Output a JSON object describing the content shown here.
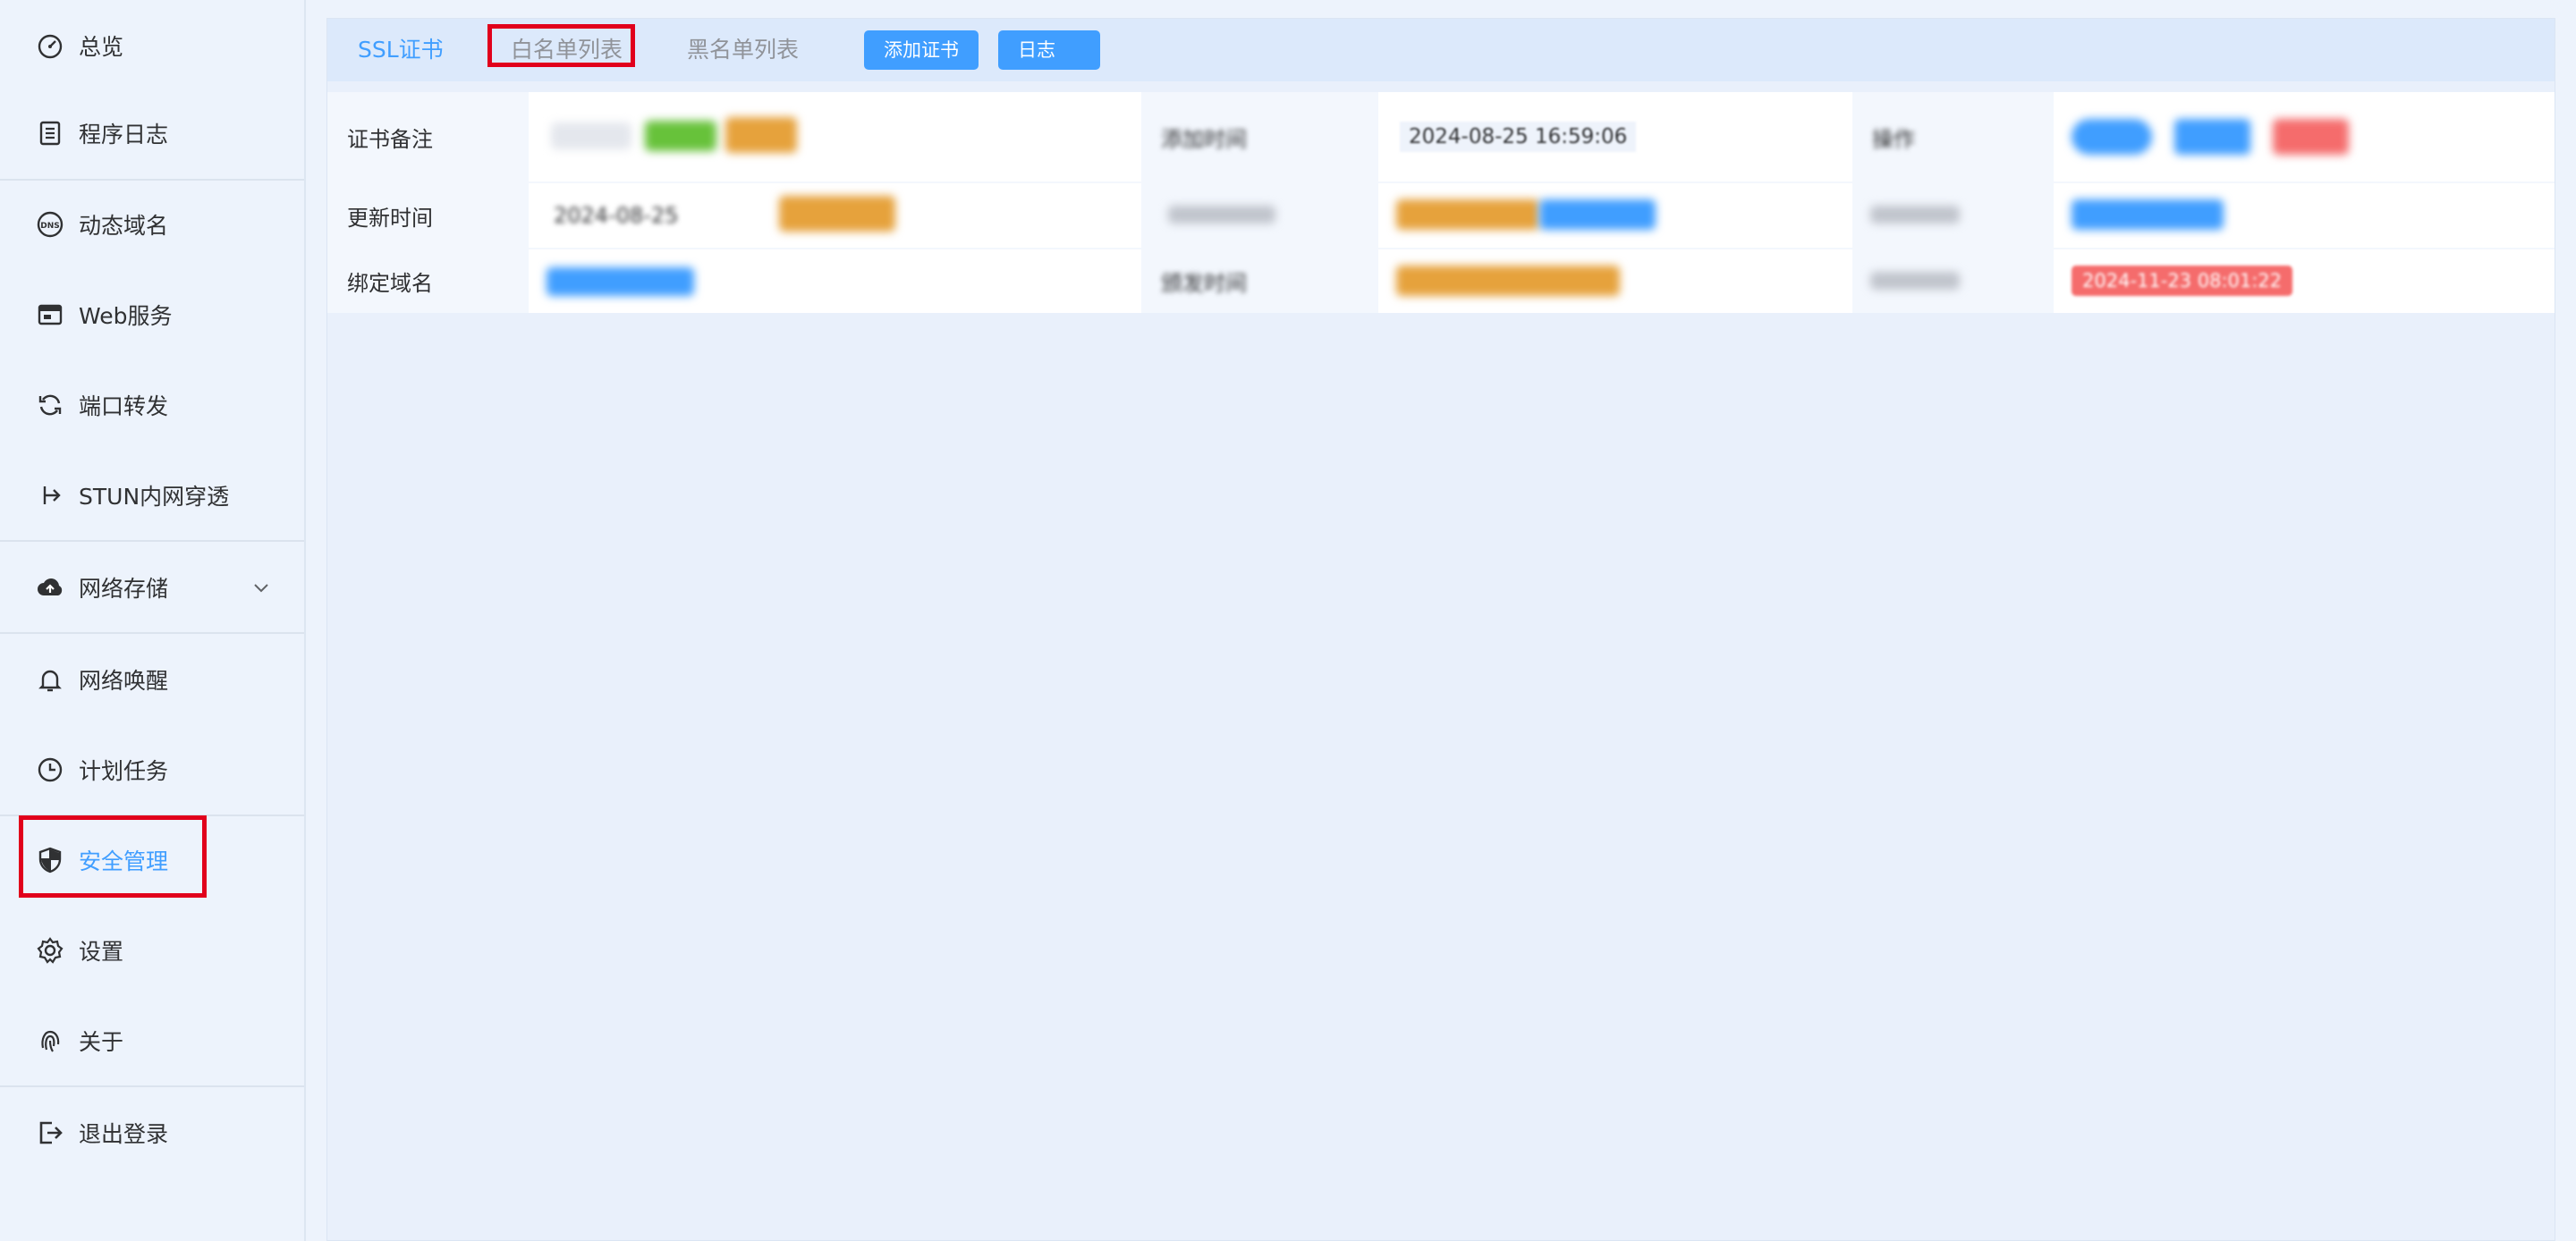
{
  "sidebar": {
    "items": [
      {
        "label": "总览",
        "icon": "dashboard-icon"
      },
      {
        "label": "程序日志",
        "icon": "log-icon"
      },
      {
        "label": "动态域名",
        "icon": "dns-icon"
      },
      {
        "label": "Web服务",
        "icon": "web-service-icon"
      },
      {
        "label": "端口转发",
        "icon": "port-forward-icon"
      },
      {
        "label": "STUN内网穿透",
        "icon": "stun-icon"
      },
      {
        "label": "网络存储",
        "icon": "cloud-upload-icon"
      },
      {
        "label": "网络唤醒",
        "icon": "bell-icon"
      },
      {
        "label": "计划任务",
        "icon": "clock-icon"
      },
      {
        "label": "安全管理",
        "icon": "shield-icon"
      },
      {
        "label": "设置",
        "icon": "gear-icon"
      },
      {
        "label": "关于",
        "icon": "fingerprint-icon"
      },
      {
        "label": "退出登录",
        "icon": "logout-icon"
      }
    ]
  },
  "tabs": {
    "ssl": "SSL证书",
    "whitelist": "白名单列表",
    "blacklist": "黑名单列表"
  },
  "toolbar": {
    "add_cert": "添加证书",
    "log": "日志"
  },
  "cert": {
    "remark_label": "证书备注",
    "added_time_label": "添加时间",
    "added_time_value": "2024-08-25 16:59:06",
    "action_label": "操作",
    "update_time_label": "更新时间",
    "update_time_value": "2024-08-25",
    "bound_domain_label": "绑定域名",
    "issue_time_label": "颁发时间",
    "expire_value": "2024-11-23 08:01:22"
  },
  "colors": {
    "accent": "#409eff",
    "highlight_red": "#e1001b",
    "tag_green": "#67c23a",
    "tag_orange": "#e6a23c",
    "tag_red": "#f56c6c"
  }
}
